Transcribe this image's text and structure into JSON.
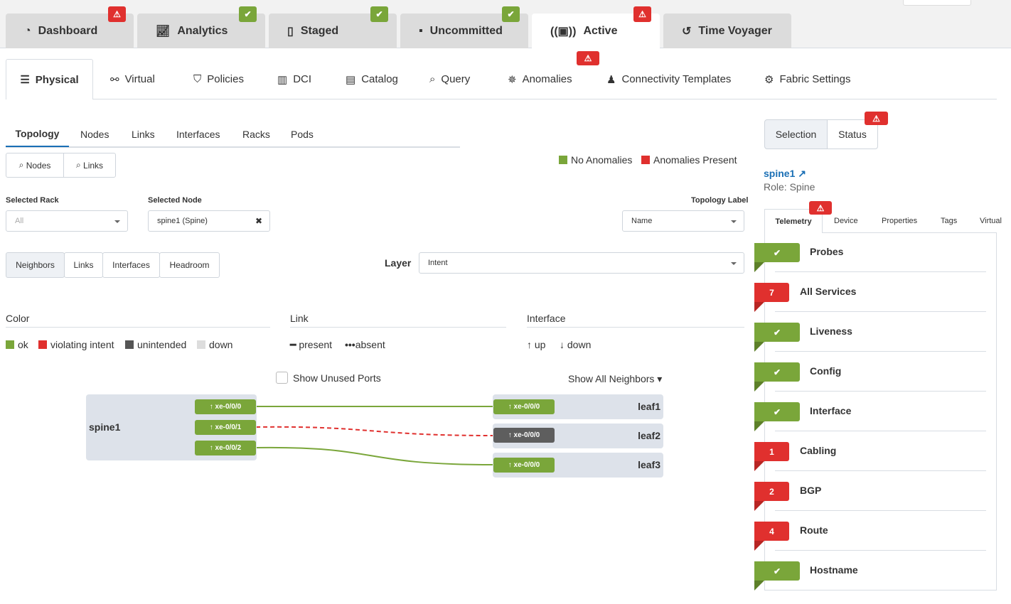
{
  "top_tabs": [
    {
      "label": "Dashboard",
      "icon": "dashboard-gauge-icon",
      "status": "warning"
    },
    {
      "label": "Analytics",
      "icon": "line-chart-icon",
      "status": "ok"
    },
    {
      "label": "Staged",
      "icon": "document-icon",
      "status": "ok"
    },
    {
      "label": "Uncommitted",
      "icon": "uncommitted-icon",
      "status": "ok"
    },
    {
      "label": "Active",
      "icon": "broadcast-icon",
      "status": "warning",
      "active": true
    },
    {
      "label": "Time Voyager",
      "icon": "history-icon"
    }
  ],
  "nav": [
    {
      "label": "Physical",
      "icon": "server-icon",
      "active": true
    },
    {
      "label": "Virtual",
      "icon": "network-icon"
    },
    {
      "label": "Policies",
      "icon": "shield-icon"
    },
    {
      "label": "DCI",
      "icon": "dci-icon"
    },
    {
      "label": "Catalog",
      "icon": "catalog-icon"
    },
    {
      "label": "Query",
      "icon": "query-icon"
    },
    {
      "label": "Anomalies",
      "icon": "anomalies-icon"
    },
    {
      "label": "Connectivity Templates",
      "icon": "hierarchy-icon"
    },
    {
      "label": "Fabric Settings",
      "icon": "fabric-settings-icon"
    }
  ],
  "subtabs": [
    "Topology",
    "Nodes",
    "Links",
    "Interfaces",
    "Racks",
    "Pods"
  ],
  "search_buttons": {
    "nodes": "Nodes",
    "links": "Links"
  },
  "legend_top": {
    "ok": "No Anomalies",
    "bad": "Anomalies Present"
  },
  "filters": {
    "rack_label": "Selected Rack",
    "rack_value": "All",
    "node_label": "Selected Node",
    "node_value": "spine1 (Spine)",
    "topo_label": "Topology Label",
    "topo_value": "Name",
    "layer_label": "Layer",
    "layer_value": "Intent"
  },
  "view_tabs": [
    "Neighbors",
    "Links",
    "Interfaces",
    "Headroom"
  ],
  "legend": {
    "color_title": "Color",
    "colors": [
      {
        "label": "ok",
        "color": "#7aa63a"
      },
      {
        "label": "violating intent",
        "color": "#e0302e"
      },
      {
        "label": "unintended",
        "color": "#555555"
      },
      {
        "label": "down",
        "color": "#dddddd"
      }
    ],
    "link_title": "Link",
    "present": "present",
    "absent": "absent",
    "interface_title": "Interface",
    "up": "up",
    "down": "down"
  },
  "show_unused": "Show Unused Ports",
  "show_all": "Show All Neighbors",
  "topology": {
    "spine": {
      "name": "spine1",
      "ports": [
        "xe-0/0/0",
        "xe-0/0/1",
        "xe-0/0/2"
      ]
    },
    "leaves": [
      {
        "name": "leaf1",
        "port": "xe-0/0/0",
        "state": "ok"
      },
      {
        "name": "leaf2",
        "port": "xe-0/0/0",
        "state": "unintended"
      },
      {
        "name": "leaf3",
        "port": "xe-0/0/0",
        "state": "ok"
      }
    ]
  },
  "right": {
    "tabs": [
      "Selection",
      "Status"
    ],
    "node_name": "spine1",
    "role": "Role: Spine",
    "detail_tabs": [
      "Telemetry",
      "Device",
      "Properties",
      "Tags",
      "Virtual"
    ],
    "telemetry": [
      {
        "name": "Probes",
        "count": null
      },
      {
        "name": "All Services",
        "count": "7"
      },
      {
        "name": "Liveness",
        "count": null
      },
      {
        "name": "Config",
        "count": null
      },
      {
        "name": "Interface",
        "count": null
      },
      {
        "name": "Cabling",
        "count": "1"
      },
      {
        "name": "BGP",
        "count": "2"
      },
      {
        "name": "Route",
        "count": "4"
      },
      {
        "name": "Hostname",
        "count": null
      }
    ]
  }
}
